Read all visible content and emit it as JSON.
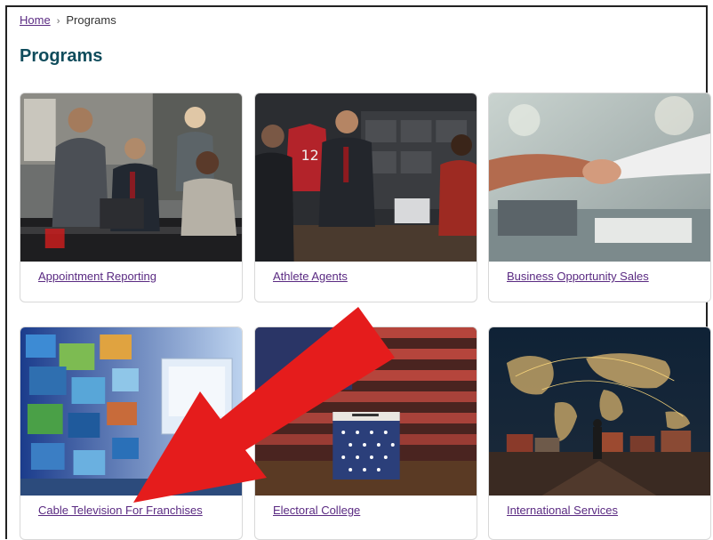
{
  "breadcrumb": {
    "home": "Home",
    "current": "Programs"
  },
  "page_title": "Programs",
  "cards": [
    {
      "label": "Appointment Reporting",
      "image": "office-meeting-photo"
    },
    {
      "label": "Athlete Agents",
      "image": "sports-agent-meeting-photo"
    },
    {
      "label": "Business Opportunity Sales",
      "image": "handshake-photo"
    },
    {
      "label": "Cable Television For Franchises",
      "image": "tv-screens-photo"
    },
    {
      "label": "Electoral College",
      "image": "ballot-box-flag-photo"
    },
    {
      "label": "International Services",
      "image": "world-map-logistics-photo"
    }
  ],
  "annotation": {
    "arrow_color": "#e51c1c"
  }
}
